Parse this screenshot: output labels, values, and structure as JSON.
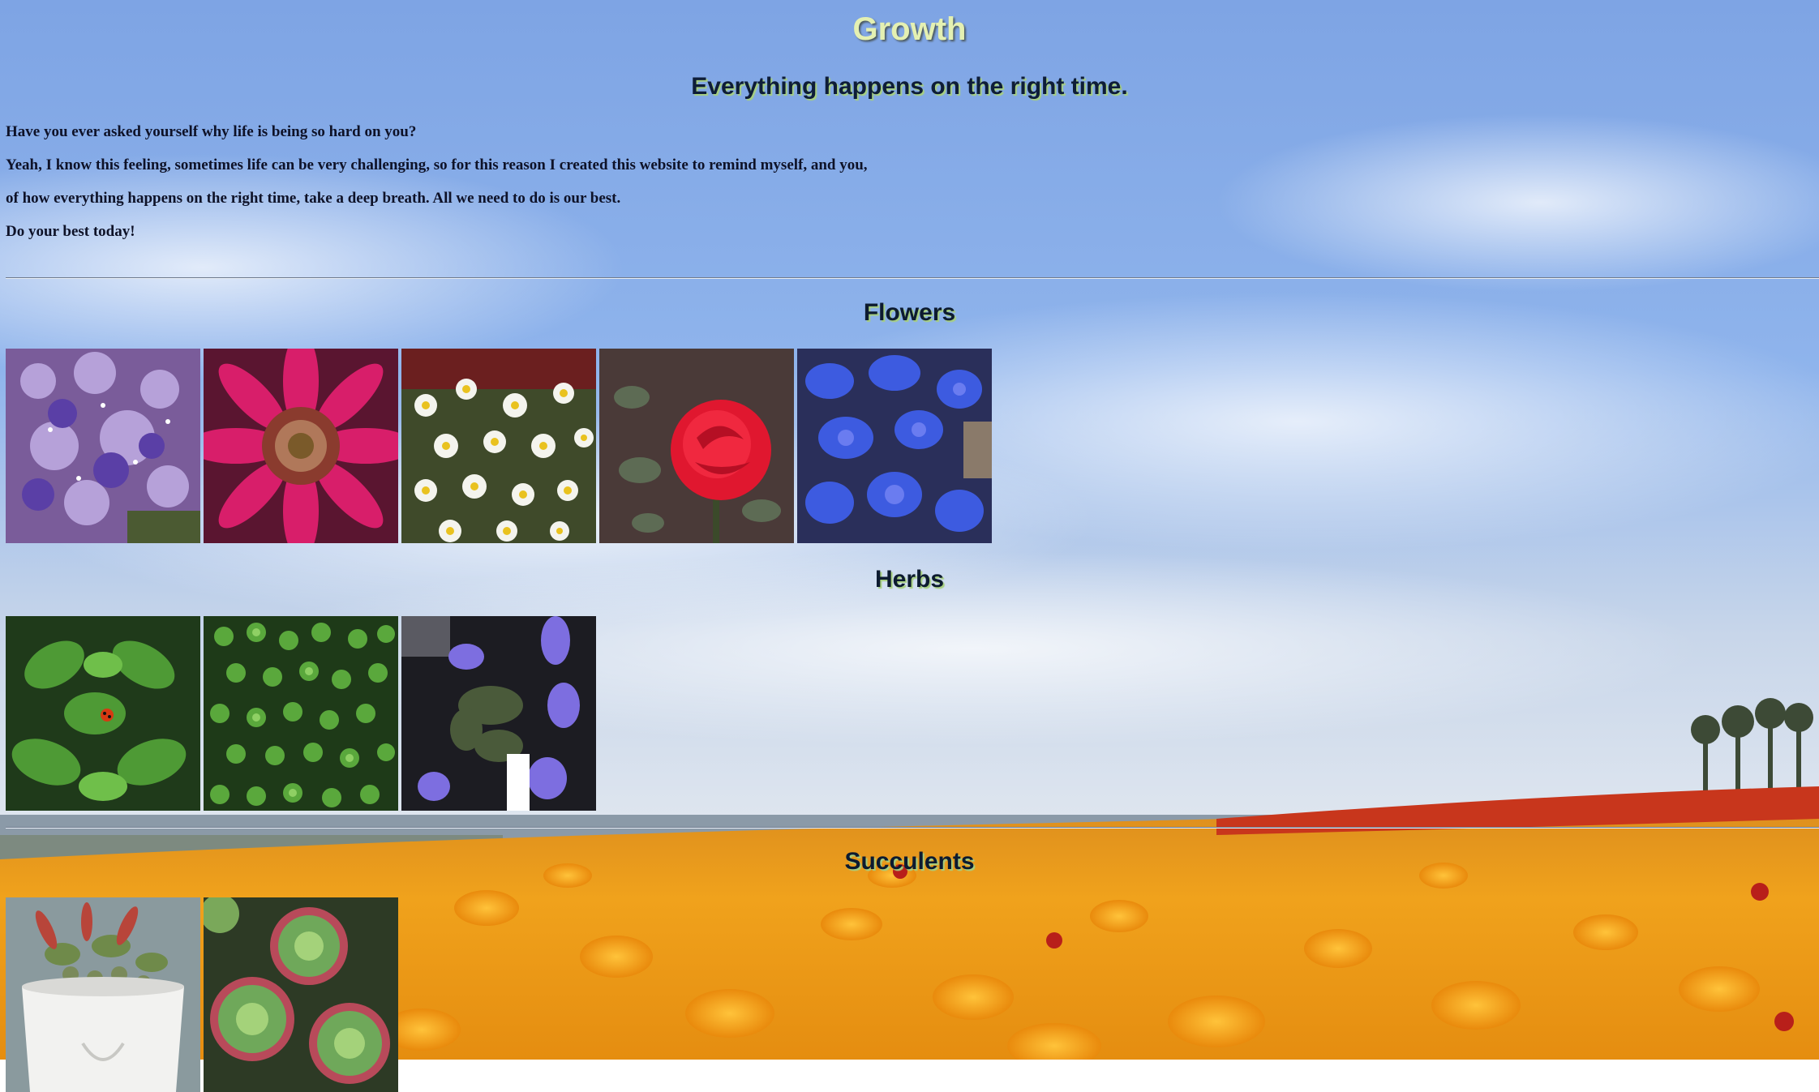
{
  "header": {
    "title": "Growth",
    "subtitle": "Everything happens on the right time."
  },
  "intro": [
    "Have you ever asked yourself why life is being so hard on you?",
    "Yeah, I know this feeling, sometimes life can be very challenging, so for this reason I created this website to remind myself, and you,",
    "of how everything happens on the right time, take a deep breath. All we need to do is our best.",
    "Do your best today!"
  ],
  "sections": [
    {
      "title": "Flowers",
      "photos": [
        "purple-statice-flowers",
        "pink-gerbera-daisy",
        "white-chamomile-daisies",
        "red-rose",
        "blue-orchids"
      ]
    },
    {
      "title": "Herbs",
      "photos": [
        "mint-leaves-with-ladybug",
        "oregano-plant",
        "purple-sage-blossoms"
      ]
    },
    {
      "title": "Succulents",
      "photos": [
        "succulents-in-white-face-pot",
        "echeveria-rosettes"
      ]
    }
  ],
  "background": "cloudy-sky-over-orange-ranunculus-field",
  "colors": {
    "title_text": "#e4f0b2",
    "heading_text": "#0d1b30",
    "heading_glow": "#a7cf7f",
    "body_text": "#0e1228",
    "sky_top": "#7ea6e6",
    "flower_orange": "#f29a18"
  }
}
